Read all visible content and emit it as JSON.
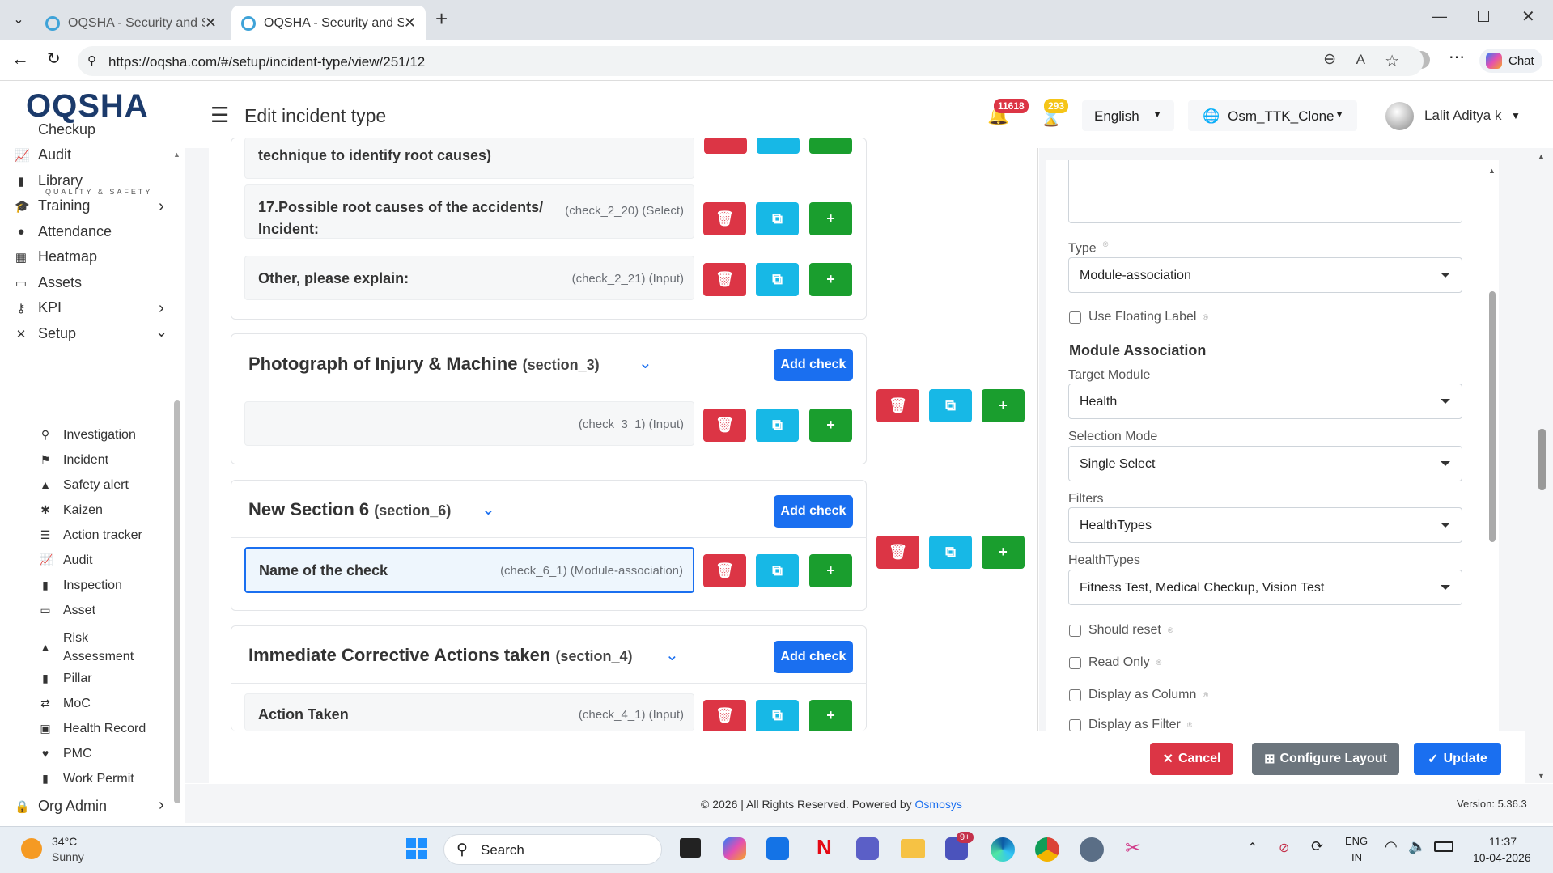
{
  "browser": {
    "tabs": [
      {
        "title": "OQSHA - Security and Safety | Rap"
      },
      {
        "title": "OQSHA - Security and Safety | Rap"
      }
    ],
    "url": "https://oqsha.com/#/setup/incident-type/view/251/12",
    "chat_label": "Chat"
  },
  "brand": {
    "logo_text": "OQSHA",
    "tagline": "QUALITY & SAFETY"
  },
  "sidebar": {
    "items": [
      {
        "label": "Checkup",
        "icon": "checkup-icon"
      },
      {
        "label": "Audit",
        "icon": "chart-icon"
      },
      {
        "label": "Library",
        "icon": "book-icon"
      },
      {
        "label": "Training",
        "icon": "graduation-icon"
      },
      {
        "label": "Attendance",
        "icon": "clock-icon"
      },
      {
        "label": "Heatmap",
        "icon": "heatmap-icon"
      },
      {
        "label": "Assets",
        "icon": "laptop-icon"
      },
      {
        "label": "KPI",
        "icon": "key-icon"
      },
      {
        "label": "Setup",
        "icon": "tools-icon"
      }
    ],
    "setup_items": [
      {
        "label": "Investigation"
      },
      {
        "label": "Incident"
      },
      {
        "label": "Safety alert"
      },
      {
        "label": "Kaizen"
      },
      {
        "label": "Action tracker"
      },
      {
        "label": "Audit"
      },
      {
        "label": "Inspection"
      },
      {
        "label": "Asset"
      },
      {
        "label": "Risk",
        "label2": "Assessment"
      },
      {
        "label": "Pillar"
      },
      {
        "label": "MoC"
      },
      {
        "label": "Health Record"
      },
      {
        "label": "PMC"
      },
      {
        "label": "Work Permit"
      }
    ],
    "org_admin": "Org Admin"
  },
  "header": {
    "title": "Edit incident type",
    "notif_count": "11618",
    "task_count": "293",
    "language": "English",
    "org": "Osm_TTK_Clone",
    "user": "Lalit Aditya k"
  },
  "sections": {
    "s2": {
      "partial_label": "technique to identify root causes)",
      "rows": [
        {
          "label": "17.Possible root causes of the accidents/",
          "label2": "Incident:",
          "meta": "(check_2_20)  (Select)"
        },
        {
          "label": "Other, please explain:",
          "meta": "(check_2_21)  (Input)"
        }
      ]
    },
    "s3": {
      "title": "Photograph of Injury & Machine",
      "id": "(section_3)",
      "add": "Add check",
      "rows": [
        {
          "label": "",
          "meta": "(check_3_1)  (Input)"
        }
      ]
    },
    "s6": {
      "title": "New Section 6",
      "id": "(section_6)",
      "add": "Add check",
      "rows": [
        {
          "label": "Name of the check",
          "meta": "(check_6_1)  (Module-association)"
        }
      ]
    },
    "s4": {
      "title": "Immediate Corrective Actions taken",
      "id": "(section_4)",
      "add": "Add check",
      "rows": [
        {
          "label": "Action Taken",
          "meta": "(check_4_1)  (Input)"
        }
      ]
    }
  },
  "panel": {
    "type_label": "Type",
    "type_value": "Module-association",
    "floating_label": "Use Floating Label",
    "module_assoc_heading": "Module Association",
    "target_module_label": "Target Module",
    "target_module_value": "Health",
    "selection_mode_label": "Selection Mode",
    "selection_mode_value": "Single Select",
    "filters_label": "Filters",
    "filters_value": "HealthTypes",
    "healthtypes_label": "HealthTypes",
    "healthtypes_value": "Fitness Test, Medical Checkup, Vision Test",
    "should_reset": "Should reset",
    "read_only": "Read Only",
    "display_column": "Display as Column",
    "display_filter": "Display as Filter"
  },
  "footer_buttons": {
    "cancel": "Cancel",
    "configure": "Configure Layout",
    "update": "Update"
  },
  "footer": {
    "copyright": "© 2026 | All Rights Reserved. Powered by",
    "powered": "Osmosys",
    "version": "Version: 5.36.3"
  },
  "taskbar": {
    "temp": "34°C",
    "weather": "Sunny",
    "search": "Search",
    "lang1": "ENG",
    "lang2": "IN",
    "time": "11:37",
    "date": "10-04-2026",
    "teams_badge": "9+"
  },
  "colors": {
    "danger": "#dc3545",
    "info": "#17b8e6",
    "success": "#1a9e2e",
    "primary": "#1a6ff0",
    "brand": "#1b3a6b"
  }
}
